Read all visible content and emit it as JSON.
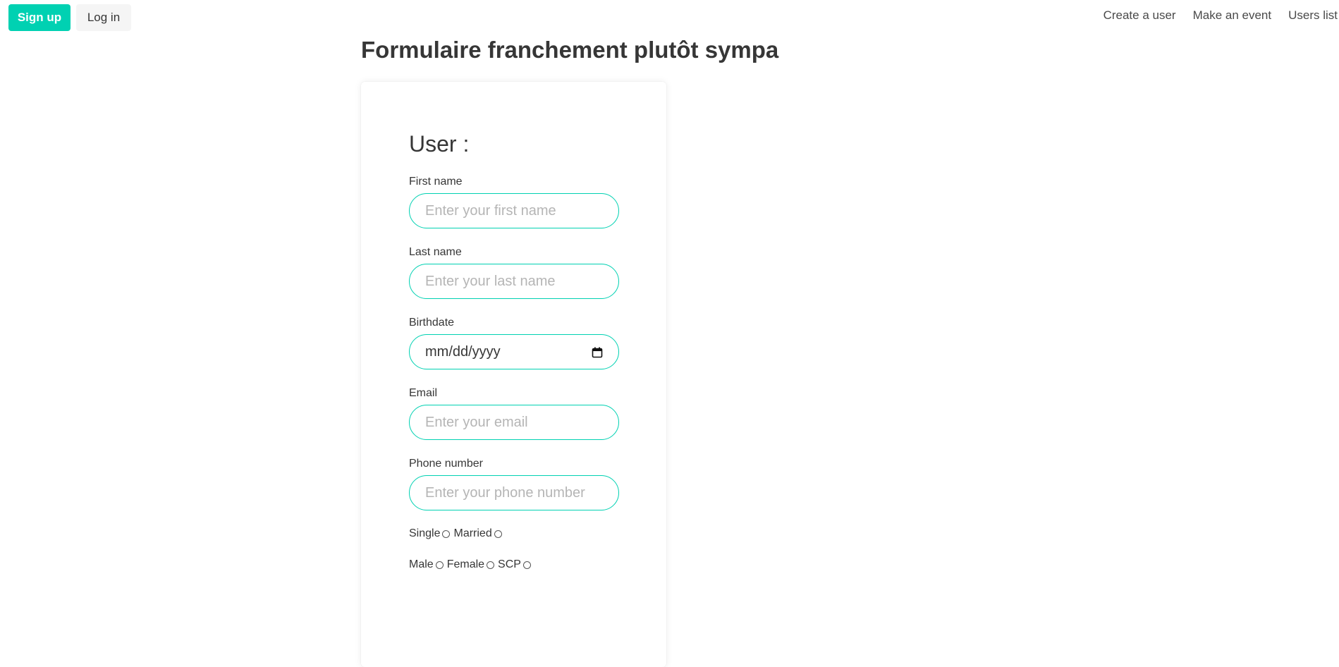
{
  "nav": {
    "signup_label": "Sign up",
    "login_label": "Log in",
    "links": [
      "Create a user",
      "Make an event",
      "Users list"
    ]
  },
  "page": {
    "title": "Formulaire franchement plutôt sympa"
  },
  "form": {
    "section_title": "User :",
    "first_name": {
      "label": "First name",
      "placeholder": "Enter your first name"
    },
    "last_name": {
      "label": "Last name",
      "placeholder": "Enter your last name"
    },
    "birthdate": {
      "label": "Birthdate",
      "placeholder": "mm/dd/yyyy"
    },
    "email": {
      "label": "Email",
      "placeholder": "Enter your email"
    },
    "phone": {
      "label": "Phone number",
      "placeholder": "Enter your phone number"
    },
    "marital": [
      "Single",
      "Married"
    ],
    "gender": [
      "Male",
      "Female",
      "SCP"
    ]
  },
  "colors": {
    "primary": "#00d1b2",
    "light_button": "#f5f5f5",
    "text": "#363636",
    "placeholder": "#b5b5b5"
  },
  "icons": {
    "date_picker": "calendar-icon"
  }
}
